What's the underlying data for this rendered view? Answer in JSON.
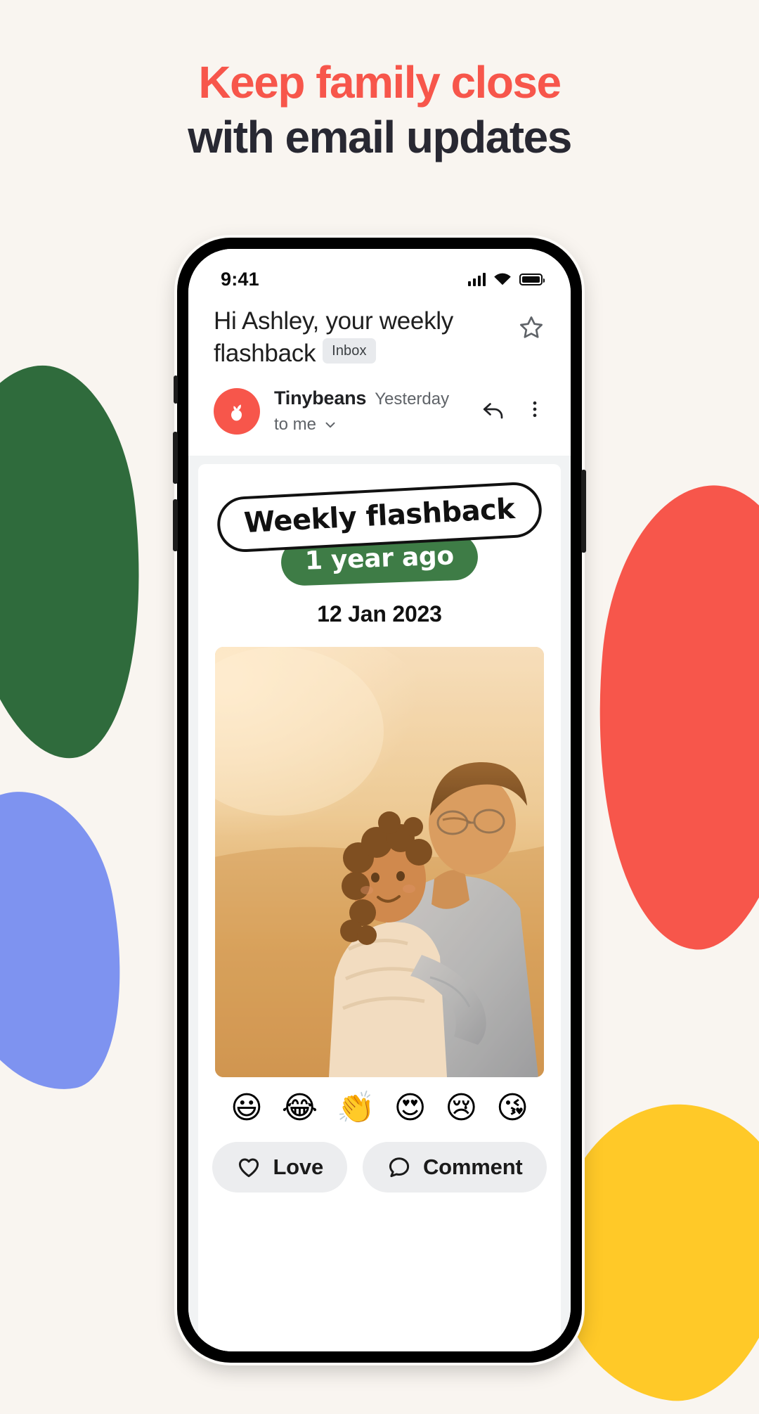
{
  "headline": {
    "line1": "Keep family close",
    "line2": "with email updates",
    "line1_color": "#F7564B",
    "line2_color": "#282832"
  },
  "background": {
    "page_color": "#F9F5F0",
    "blobs": [
      {
        "name": "green",
        "color": "#2F6B3C"
      },
      {
        "name": "red",
        "color": "#F7564B"
      },
      {
        "name": "blue",
        "color": "#7E93F0"
      },
      {
        "name": "yellow",
        "color": "#FFC928"
      }
    ]
  },
  "phone": {
    "status_bar": {
      "time": "9:41",
      "icons": [
        "cellular-signal-icon",
        "wifi-icon",
        "battery-icon"
      ]
    }
  },
  "email": {
    "subject": "Hi Ashley, your weekly flashback",
    "label_chip": "Inbox",
    "star_icon": "star-outline-icon",
    "sender_name": "Tinybeans",
    "sent_when": "Yesterday",
    "recipients": "to me",
    "recipients_caret": "chevron-down-icon",
    "reply_icon": "reply-arrow-icon",
    "more_icon": "more-vertical-icon",
    "avatar_color": "#F7564B",
    "avatar_icon": "tinybeans-sprout-logo-icon"
  },
  "flashback": {
    "title_pill": "Weekly flashback",
    "age_badge": "1 year ago",
    "age_badge_color": "#3E7C46",
    "date": "12 Jan 2023",
    "photo_alt": "Father kissing young daughter outdoors at golden hour"
  },
  "reactions": {
    "emojis": [
      "😃",
      "😂",
      "👏",
      "😍",
      "😢",
      "😘"
    ],
    "names": [
      "grinning-face-emoji",
      "tears-of-joy-emoji",
      "clapping-hands-emoji",
      "heart-eyes-emoji",
      "crying-face-emoji",
      "kissing-heart-emoji"
    ]
  },
  "actions": {
    "love_label": "Love",
    "love_icon": "heart-outline-icon",
    "comment_label": "Comment",
    "comment_icon": "comment-bubble-icon"
  }
}
